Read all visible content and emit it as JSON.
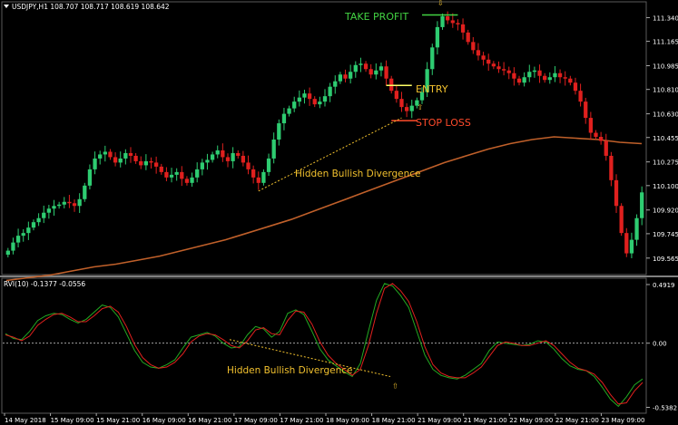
{
  "chart_data": [
    {
      "type": "candlestick",
      "title": "USDJPY,H1  108.707 108.717 108.619 108.642",
      "symbol_label": "USDJPY,H1",
      "ohlc_readout": "108.707 108.717 108.619 108.642",
      "ylim": [
        109.45,
        111.45
      ],
      "y_ticks": [
        "111.340",
        "111.165",
        "110.985",
        "110.810",
        "110.630",
        "110.455",
        "110.275",
        "110.100",
        "109.920",
        "109.745",
        "109.565"
      ],
      "x_ticks": [
        "14 May 2018",
        "15 May 09:00",
        "15 May 21:00",
        "16 May 09:00",
        "16 May 21:00",
        "17 May 09:00",
        "17 May 21:00",
        "18 May 09:00",
        "18 May 21:00",
        "21 May 09:00",
        "21 May 21:00",
        "22 May 09:00",
        "22 May 21:00",
        "23 May 09:00"
      ],
      "colors": {
        "bull": "#2ecc71",
        "bear": "#e0201e",
        "ma": "#c0602a",
        "label": "#f2c12e",
        "take_profit": "#43d343",
        "stop_loss": "#ff4b2b",
        "grid": "#3a3a3a"
      },
      "annotations": {
        "take_profit": "TAKE PROFIT",
        "entry": "ENTRY",
        "stop_loss": "STOP LOSS",
        "divergence": "Hidden Bullish Divergence"
      },
      "levels": {
        "take_profit": 111.36,
        "entry": 110.84,
        "stop_loss": 110.58
      },
      "candles_close": [
        109.62,
        109.68,
        109.73,
        109.75,
        109.79,
        109.83,
        109.86,
        109.9,
        109.93,
        109.95,
        109.96,
        109.98,
        109.97,
        109.95,
        110.0,
        110.1,
        110.22,
        110.3,
        110.33,
        110.35,
        110.31,
        110.27,
        110.3,
        110.34,
        110.32,
        110.28,
        110.25,
        110.28,
        110.27,
        110.24,
        110.2,
        110.16,
        110.18,
        110.2,
        110.15,
        110.12,
        110.16,
        110.22,
        110.27,
        110.29,
        110.33,
        110.36,
        110.31,
        110.28,
        110.34,
        110.32,
        110.27,
        110.22,
        110.16,
        110.12,
        110.2,
        110.3,
        110.44,
        110.56,
        110.63,
        110.67,
        110.72,
        110.75,
        110.78,
        110.74,
        110.7,
        110.72,
        110.76,
        110.83,
        110.87,
        110.92,
        110.89,
        110.94,
        110.99,
        111.0,
        110.96,
        110.92,
        110.95,
        110.98,
        110.89,
        110.8,
        110.74,
        110.68,
        110.65,
        110.69,
        110.73,
        110.79,
        110.96,
        111.12,
        111.27,
        111.35,
        111.32,
        111.3,
        111.29,
        111.23,
        111.16,
        111.1,
        111.06,
        111.03,
        111.0,
        110.98,
        110.96,
        110.95,
        110.93,
        110.89,
        110.86,
        110.9,
        110.94,
        110.95,
        110.91,
        110.88,
        110.9,
        110.93,
        110.9,
        110.89,
        110.86,
        110.8,
        110.72,
        110.6,
        110.49,
        110.46,
        110.43,
        110.32,
        110.14,
        109.95,
        109.75,
        109.6,
        109.7,
        109.86,
        110.05
      ],
      "ma_values": [
        109.4,
        109.42,
        109.44,
        109.47,
        109.5,
        109.52,
        109.55,
        109.58,
        109.62,
        109.66,
        109.7,
        109.75,
        109.8,
        109.85,
        109.91,
        109.97,
        110.03,
        110.09,
        110.15,
        110.21,
        110.27,
        110.32,
        110.37,
        110.41,
        110.44,
        110.46,
        110.45,
        110.44,
        110.42,
        110.41
      ]
    },
    {
      "type": "line",
      "title": "RVI(10) -0.1377 -0.0556",
      "indicator_label": "RVI(10)",
      "indicator_readout": "-0.1377 -0.0556",
      "ylim": [
        -0.58,
        0.53
      ],
      "y_ticks": [
        "0.4919",
        "0.00",
        "-0.5382"
      ],
      "zero_label": "0.00",
      "annotation": "Hidden Bullish Divergence",
      "series": [
        {
          "color": "#22aa22",
          "values": [
            0.08,
            0.04,
            0.03,
            0.1,
            0.19,
            0.23,
            0.25,
            0.24,
            0.2,
            0.17,
            0.2,
            0.26,
            0.32,
            0.3,
            0.22,
            0.08,
            -0.06,
            -0.16,
            -0.2,
            -0.21,
            -0.18,
            -0.14,
            -0.04,
            0.05,
            0.07,
            0.09,
            0.06,
            0.0,
            -0.04,
            -0.03,
            0.07,
            0.14,
            0.12,
            0.05,
            0.1,
            0.25,
            0.28,
            0.24,
            0.1,
            -0.05,
            -0.14,
            -0.19,
            -0.24,
            -0.28,
            -0.17,
            0.1,
            0.36,
            0.5,
            0.48,
            0.4,
            0.3,
            0.1,
            -0.1,
            -0.22,
            -0.27,
            -0.29,
            -0.3,
            -0.27,
            -0.22,
            -0.17,
            -0.06,
            0.01,
            0.0,
            -0.01,
            -0.02,
            -0.01,
            0.02,
            0.01,
            -0.05,
            -0.13,
            -0.19,
            -0.22,
            -0.23,
            -0.28,
            -0.37,
            -0.47,
            -0.53,
            -0.45,
            -0.35,
            -0.3
          ]
        },
        {
          "color": "#e0201e",
          "values": [
            0.07,
            0.05,
            0.02,
            0.06,
            0.15,
            0.2,
            0.24,
            0.25,
            0.22,
            0.18,
            0.18,
            0.23,
            0.29,
            0.31,
            0.26,
            0.14,
            -0.01,
            -0.12,
            -0.18,
            -0.21,
            -0.2,
            -0.16,
            -0.09,
            0.01,
            0.06,
            0.08,
            0.07,
            0.03,
            -0.02,
            -0.04,
            0.02,
            0.11,
            0.13,
            0.08,
            0.07,
            0.19,
            0.27,
            0.26,
            0.16,
            0.01,
            -0.1,
            -0.17,
            -0.22,
            -0.27,
            -0.22,
            -0.02,
            0.25,
            0.46,
            0.5,
            0.44,
            0.35,
            0.18,
            -0.03,
            -0.18,
            -0.25,
            -0.28,
            -0.29,
            -0.29,
            -0.25,
            -0.2,
            -0.11,
            -0.02,
            0.01,
            0.0,
            -0.02,
            -0.02,
            0.0,
            0.02,
            -0.02,
            -0.09,
            -0.16,
            -0.21,
            -0.23,
            -0.26,
            -0.33,
            -0.43,
            -0.51,
            -0.5,
            -0.4,
            -0.33
          ]
        }
      ]
    }
  ]
}
